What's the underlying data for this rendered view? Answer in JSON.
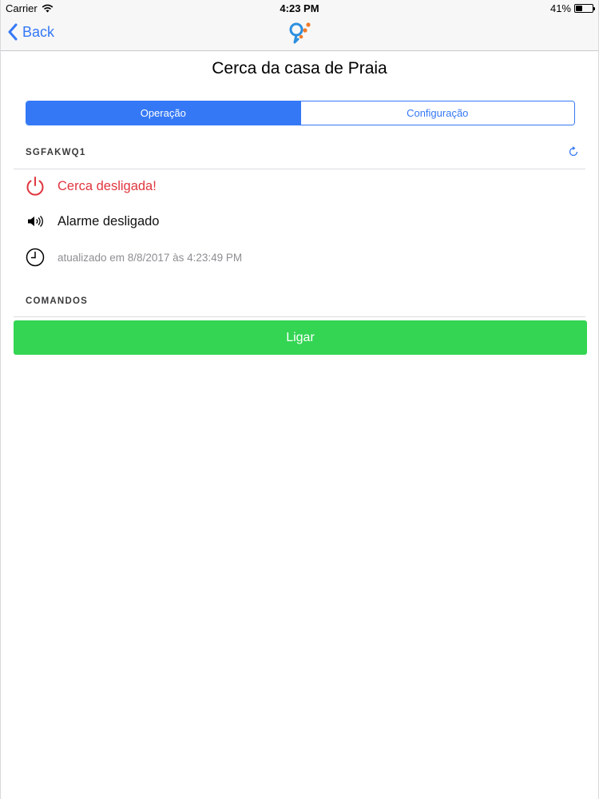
{
  "status_bar": {
    "carrier": "Carrier",
    "time": "4:23 PM",
    "battery_percent": "41%",
    "battery_level": 0.41
  },
  "nav": {
    "back_label": "Back",
    "logo_icon": "app-logo-icon",
    "accent_color": "#3478f6"
  },
  "page": {
    "title": "Cerca da casa de Praia"
  },
  "tabs": [
    {
      "label": "Operação",
      "active": true
    },
    {
      "label": "Configuração",
      "active": false
    }
  ],
  "device": {
    "id": "SGFAKWQ1",
    "refresh_icon": "refresh-icon"
  },
  "status": {
    "fence": {
      "icon": "power-icon",
      "text": "Cerca desligada!",
      "color": "#e0363f"
    },
    "alarm": {
      "icon": "speaker-icon",
      "text": "Alarme desligado"
    },
    "updated": {
      "icon": "clock-icon",
      "text": "atualizado em 8/8/2017 às 4:23:49 PM"
    }
  },
  "commands": {
    "header": "COMANDOS",
    "primary_button": {
      "label": "Ligar",
      "color": "#33d552"
    }
  }
}
